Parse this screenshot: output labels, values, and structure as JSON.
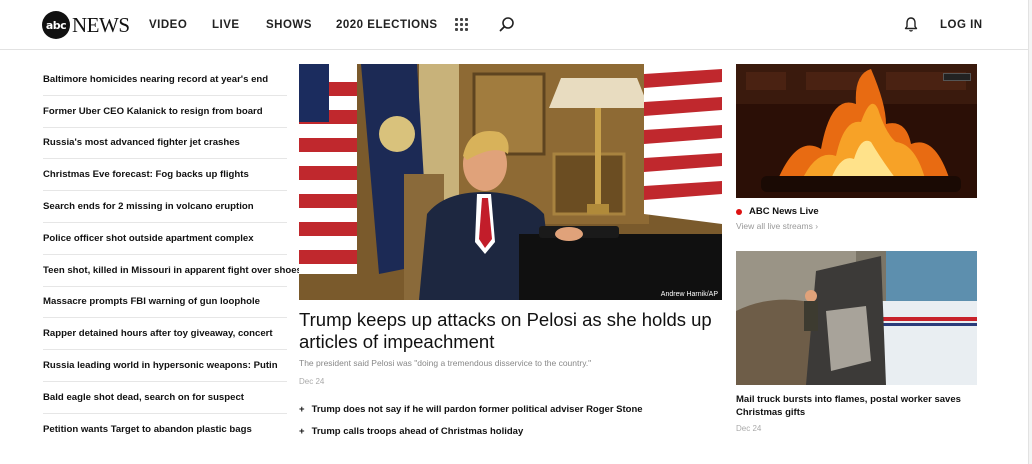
{
  "header": {
    "logo_mark": "abc",
    "logo_text": "NEWS",
    "nav": [
      "VIDEO",
      "LIVE",
      "SHOWS",
      "2020 ELECTIONS"
    ],
    "login_label": "LOG IN",
    "icons": [
      "grid-icon",
      "search-icon",
      "bell-icon"
    ]
  },
  "headlines": [
    "Baltimore homicides nearing record at year's end",
    "Former Uber CEO Kalanick to resign from board",
    "Russia's most advanced fighter jet crashes",
    "Christmas Eve forecast: Fog backs up flights",
    "Search ends for 2 missing in volcano eruption",
    "Police officer shot outside apartment complex",
    "Teen shot, killed in Missouri in apparent fight over shoes",
    "Massacre prompts FBI warning of gun loophole",
    "Rapper detained hours after toy giveaway, concert",
    "Russia leading world in hypersonic weapons: Putin",
    "Bald eagle shot dead, search on for suspect",
    "Petition wants Target to abandon plastic bags"
  ],
  "hero": {
    "credit": "Andrew Harnik/AP",
    "title": "Trump keeps up attacks on Pelosi as she holds up articles of impeachment",
    "description": "The president said Pelosi was \"doing a tremendous disservice to the country.\"",
    "date": "Dec 24",
    "related": [
      "Trump does not say if he will pardon former political adviser Roger Stone",
      "Trump calls troops ahead of Christmas holiday"
    ]
  },
  "right": {
    "live_label": "ABC News Live",
    "live_link": "View all live streams ›",
    "story_title": "Mail truck bursts into flames, postal worker saves Christmas gifts",
    "story_date": "Dec 24"
  },
  "colors": {
    "live_dot": "#dd1111",
    "text": "#111111",
    "muted": "#888888"
  }
}
